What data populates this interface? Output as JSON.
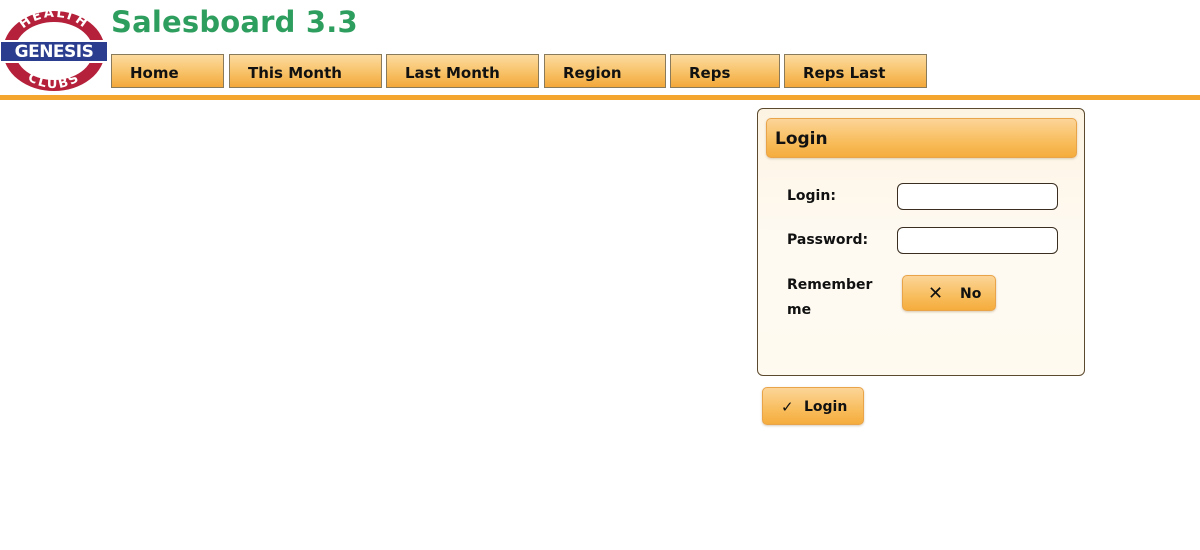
{
  "logo": {
    "top_text": "HEALTH",
    "center_text": "GENESIS",
    "bottom_text": "CLUBS",
    "colors": {
      "ring": "#b5203a",
      "center_band": "#2b3d8f"
    }
  },
  "app_title": "Salesboard 3.3",
  "nav": {
    "tabs": [
      {
        "label": "Home"
      },
      {
        "label": "This Month"
      },
      {
        "label": "Last Month"
      },
      {
        "label": "Region"
      },
      {
        "label": "Reps"
      },
      {
        "label": "Reps Last"
      }
    ]
  },
  "login_panel": {
    "title": "Login",
    "login_label": "Login:",
    "login_value": "",
    "password_label": "Password:",
    "password_value": "",
    "remember_label": "Remember me",
    "remember_toggle": {
      "icon": "x-icon",
      "label": "No"
    }
  },
  "submit": {
    "icon": "check-icon",
    "label": "Login"
  },
  "colors": {
    "accent": "#f4a52e",
    "title_green": "#2e9e5e"
  }
}
